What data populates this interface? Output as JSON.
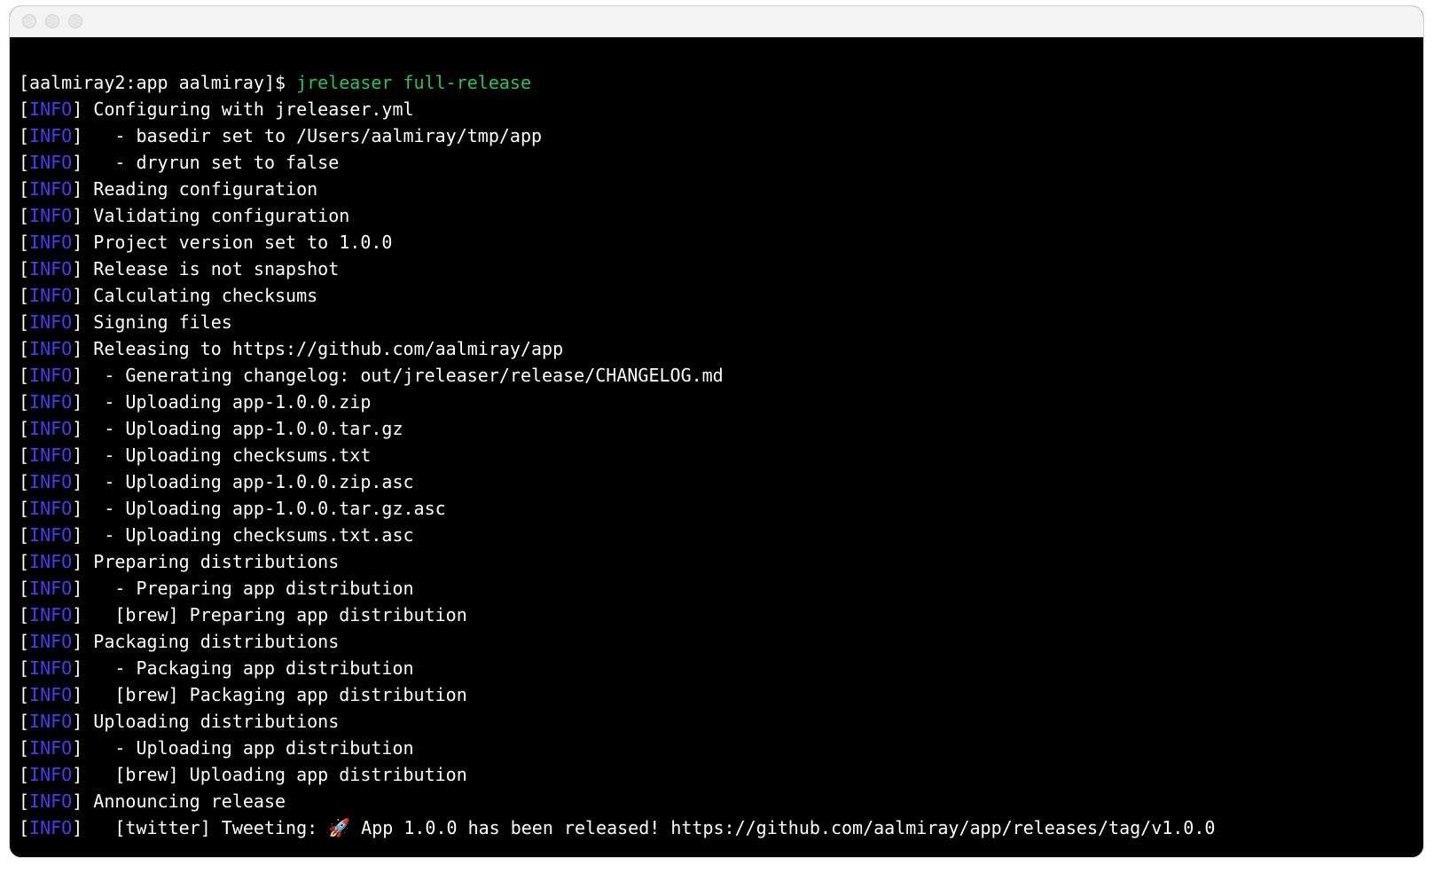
{
  "prompt": {
    "prefix": "[aalmiray2:app aalmiray]$ ",
    "command": "jreleaser full-release"
  },
  "tag": "INFO",
  "lines": [
    {
      "text": " Configuring with jreleaser.yml"
    },
    {
      "text": "   - basedir set to /Users/aalmiray/tmp/app"
    },
    {
      "text": "   - dryrun set to false"
    },
    {
      "text": " Reading configuration"
    },
    {
      "text": " Validating configuration"
    },
    {
      "text": " Project version set to 1.0.0"
    },
    {
      "text": " Release is not snapshot"
    },
    {
      "text": " Calculating checksums"
    },
    {
      "text": " Signing files"
    },
    {
      "text": " Releasing to https://github.com/aalmiray/app"
    },
    {
      "text": "  - Generating changelog: out/jreleaser/release/CHANGELOG.md"
    },
    {
      "text": "  - Uploading app-1.0.0.zip"
    },
    {
      "text": "  - Uploading app-1.0.0.tar.gz"
    },
    {
      "text": "  - Uploading checksums.txt"
    },
    {
      "text": "  - Uploading app-1.0.0.zip.asc"
    },
    {
      "text": "  - Uploading app-1.0.0.tar.gz.asc"
    },
    {
      "text": "  - Uploading checksums.txt.asc"
    },
    {
      "text": " Preparing distributions"
    },
    {
      "text": "   - Preparing app distribution"
    },
    {
      "text": "   [brew] Preparing app distribution"
    },
    {
      "text": " Packaging distributions"
    },
    {
      "text": "   - Packaging app distribution"
    },
    {
      "text": "   [brew] Packaging app distribution"
    },
    {
      "text": " Uploading distributions"
    },
    {
      "text": "   - Uploading app distribution"
    },
    {
      "text": "   [brew] Uploading app distribution"
    },
    {
      "text": " Announcing release"
    },
    {
      "text": "   [twitter] Tweeting: 🚀 App 1.0.0 has been released! https://github.com/aalmiray/app/releases/tag/v1.0.0"
    }
  ]
}
